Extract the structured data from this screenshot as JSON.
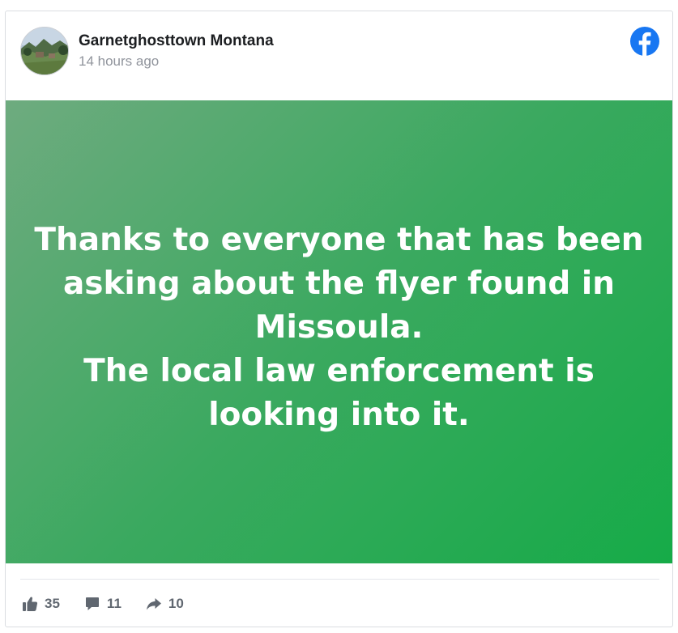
{
  "post": {
    "author": "Garnetghosttown Montana",
    "timestamp": "14 hours ago",
    "text": "Thanks to everyone that has been asking about the flyer found in Missoula.\nThe local law enforcement is looking into it.",
    "background_colors": [
      "#6eab7f",
      "#3aa95f",
      "#16ab48"
    ]
  },
  "stats": {
    "likes": "35",
    "comments": "11",
    "shares": "10"
  },
  "icons": {
    "brand": "facebook-icon",
    "like": "thumbs-up-icon",
    "comment": "comment-icon",
    "share": "share-icon"
  },
  "colors": {
    "facebook_blue": "#1877f2",
    "stat_gray": "#606770"
  }
}
